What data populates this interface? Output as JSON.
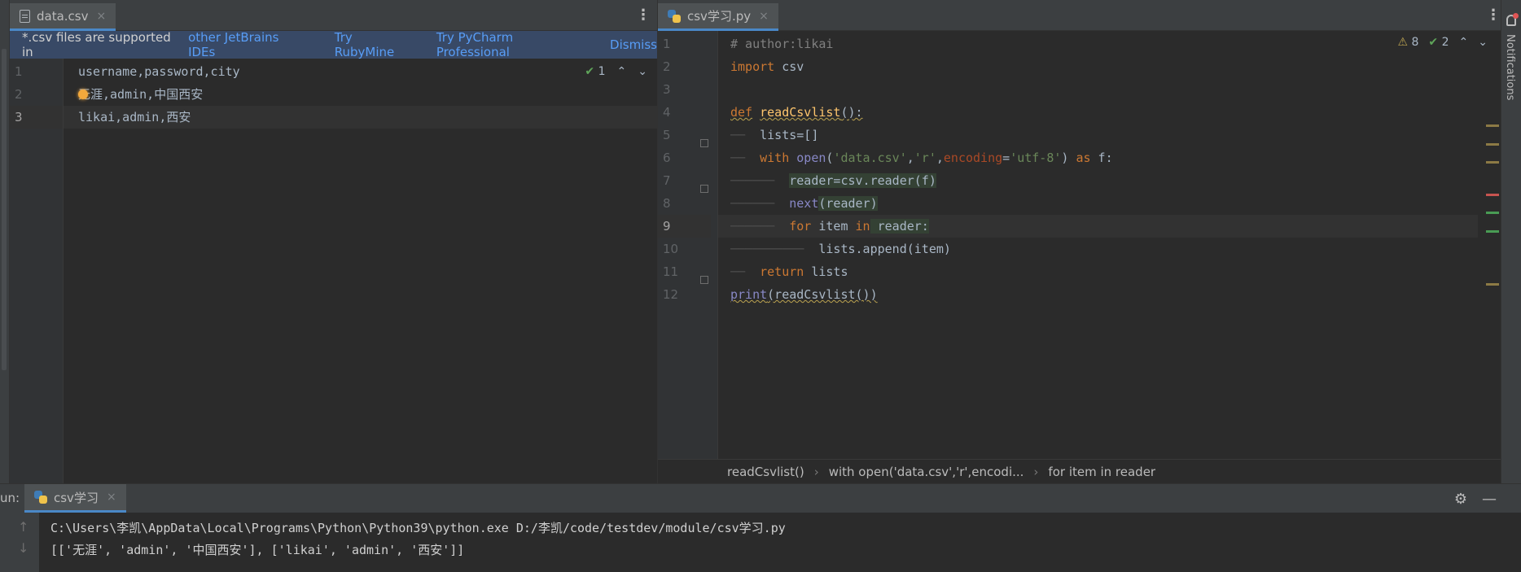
{
  "left_editor": {
    "tab": {
      "label": "data.csv",
      "close": "×"
    },
    "banner": {
      "text": "*.csv files are supported in",
      "link1": "other JetBrains IDEs",
      "link2": "Try RubyMine",
      "link3": "Try PyCharm Professional",
      "link4": "Dismiss"
    },
    "inspection": {
      "count": "1"
    },
    "line_numbers": [
      "1",
      "2",
      "3"
    ],
    "lines": [
      "username,password,city",
      "无涯,admin,中国西安",
      "likai,admin,西安"
    ]
  },
  "right_editor": {
    "tab": {
      "label": "csv学习.py",
      "close": "×"
    },
    "inspection": {
      "warnings": "8",
      "ok": "2"
    },
    "line_numbers": [
      "1",
      "2",
      "3",
      "4",
      "5",
      "6",
      "7",
      "8",
      "9",
      "10",
      "11",
      "12"
    ],
    "code": {
      "l1": "# author:likai",
      "l2_kw": "import",
      "l2_rest": " csv",
      "l4_kw": "def",
      "l4_fn": "readCsvlist",
      "l4_rest": "():",
      "l5": "lists=[]",
      "l6_kw": "with",
      "l6_open": "open",
      "l6_s1": "'data.csv'",
      "l6_s2": "'r'",
      "l6_param": "encoding",
      "l6_s3": "'utf-8'",
      "l6_as": "as",
      "l6_f": " f:",
      "l7": "reader=csv.reader(f)",
      "l8_bi": "next",
      "l8_rest": "(reader)",
      "l9_for": "for",
      "l9_item": " item ",
      "l9_in": "in",
      "l9_rest": " reader:",
      "l10": "lists.append(item)",
      "l11_kw": "return",
      "l11_rest": " lists",
      "l12_bi": "print",
      "l12_rest": "(readCsvlist())"
    },
    "breadcrumbs": [
      "readCsvlist()",
      "with open('data.csv','r',encodi...",
      "for item in reader"
    ]
  },
  "notifications": {
    "label": "Notifications"
  },
  "run_panel": {
    "label": "un:",
    "tab": "csv学习",
    "close": "×",
    "console_lines": [
      "C:\\Users\\李凯\\AppData\\Local\\Programs\\Python\\Python39\\python.exe D:/李凯/code/testdev/module/csv学习.py",
      "[['无涯', 'admin', '中国西安'], ['likai', 'admin', '西安']]"
    ]
  },
  "colors": {
    "accent": "#4a88c7",
    "keyword": "#cc7832",
    "string": "#6a8759",
    "function": "#ffc66d",
    "banner": "#384966"
  }
}
